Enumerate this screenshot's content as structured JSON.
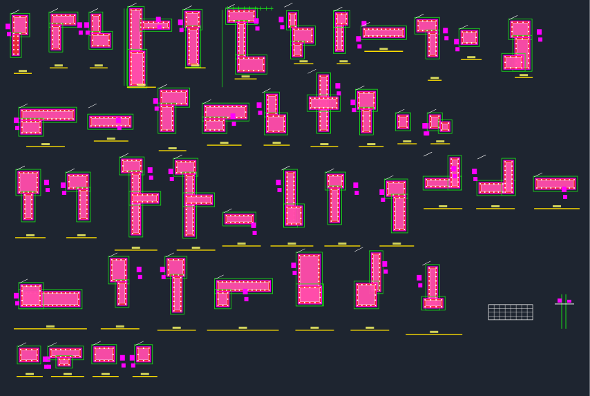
{
  "drawing": {
    "background": "#1e2530",
    "colors": {
      "outline": "#19e619",
      "rebar": "#ff00ff",
      "hatch": "#ff2a3a",
      "core": "#ff66ff",
      "title_line": "#ffe000",
      "label": "#ffff66",
      "table": "#e6e6e6",
      "dim": "#c8c8c8",
      "column_fill": "#ffe8a0"
    },
    "sheet_title": "",
    "units": ""
  }
}
